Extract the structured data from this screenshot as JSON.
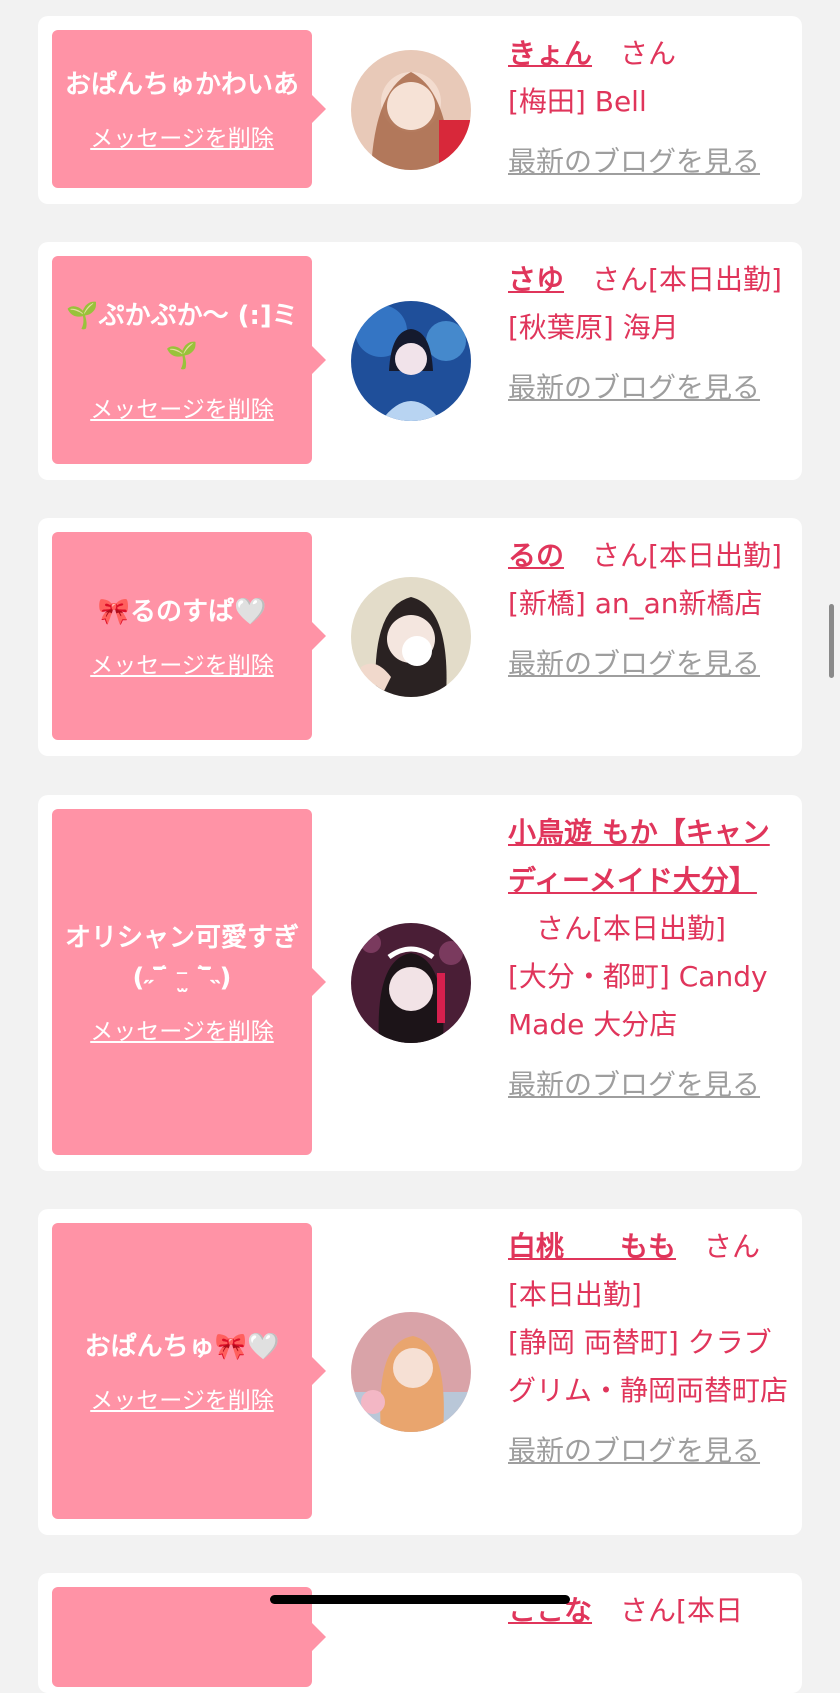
{
  "cards": [
    {
      "message": "おぱんちゅかわいあ",
      "delete_label": "メッセージを削除",
      "name": "きょん",
      "san": "さん",
      "status": "",
      "shop": "[梅田] Bell",
      "blog_label": "最新のブログを見る"
    },
    {
      "message": "🌱ぷかぷか〜 (:]ミ🌱",
      "delete_label": "メッセージを削除",
      "name": "さゆ",
      "san": "さん",
      "status": "[本日出勤]",
      "shop": "[秋葉原] 海月",
      "blog_label": "最新のブログを見る"
    },
    {
      "message": "🎀るのすぱ🤍",
      "delete_label": "メッセージを削除",
      "name": "るの",
      "san": "さん",
      "status": "[本日出勤]",
      "shop": "[新橋] an_an新橋店",
      "blog_label": "最新のブログを見る"
    },
    {
      "message": "オリシャン可愛すぎ(˶‾᷄ ⁻̫ ‾᷅˵)",
      "delete_label": "メッセージを削除",
      "name": "小鳥遊 もか【キャンディーメイド大分】",
      "san": "さん",
      "status": "[本日出勤]",
      "shop": "[大分・都町] Candy Made 大分店",
      "blog_label": "最新のブログを見る"
    },
    {
      "message": "おぱんちゅ🎀🤍",
      "delete_label": "メッセージを削除",
      "name": "白桃　　もも",
      "san": "さん",
      "status": "[本日出勤]",
      "shop": "[静岡 両替町] クラブグリム・静岡両替町店",
      "blog_label": "最新のブログを見る"
    },
    {
      "message": "",
      "delete_label": "",
      "name": "ここな",
      "san": "さん",
      "status": "[本日",
      "shop": "",
      "blog_label": ""
    }
  ]
}
